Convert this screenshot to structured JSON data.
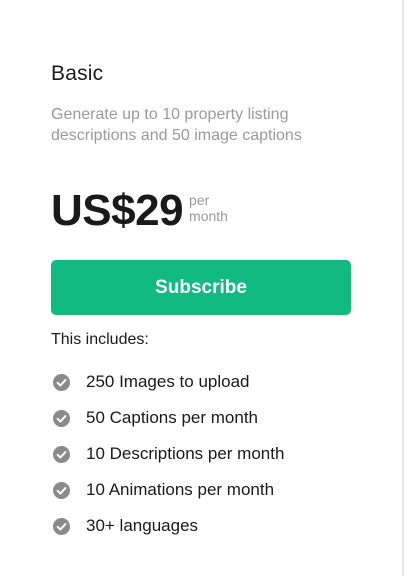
{
  "plan": {
    "name": "Basic",
    "description": "Generate up to 10 property listing descriptions and 50 image captions",
    "price": "US$29",
    "period_line1": "per",
    "period_line2": "month",
    "subscribe_label": "Subscribe",
    "includes_label": "This includes:",
    "features": [
      {
        "icon": "check-circle-icon",
        "label": "250 Images to upload"
      },
      {
        "icon": "check-circle-icon",
        "label": "50 Captions per month"
      },
      {
        "icon": "check-circle-icon",
        "label": "10 Descriptions per month"
      },
      {
        "icon": "check-circle-icon",
        "label": "10 Animations per month"
      },
      {
        "icon": "check-circle-icon",
        "label": "30+ languages"
      }
    ]
  },
  "colors": {
    "accent": "#12b981",
    "muted_text": "#9a9a9a",
    "check_icon": "#8a8a8a"
  }
}
